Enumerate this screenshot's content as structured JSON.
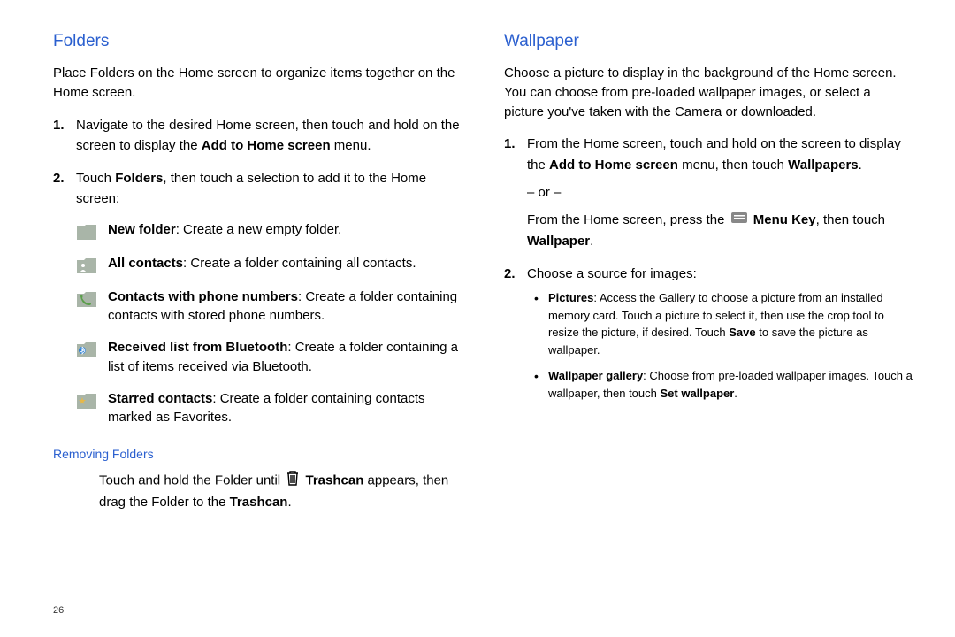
{
  "page_number": "26",
  "left": {
    "title": "Folders",
    "intro": "Place Folders on the Home screen to organize items together on the Home screen.",
    "step1_a": "Navigate to the desired Home screen, then touch and hold on the screen to display the ",
    "step1_bold": "Add to Home screen",
    "step1_b": " menu.",
    "step2_a": "Touch ",
    "step2_bold": "Folders",
    "step2_b": ", then touch a selection to add it to the Home screen:",
    "items": [
      {
        "bold": "New folder",
        "rest": ": Create a new empty folder."
      },
      {
        "bold": "All contacts",
        "rest": ": Create a folder containing all contacts."
      },
      {
        "bold": "Contacts with phone numbers",
        "rest": ": Create a folder containing contacts with stored phone numbers."
      },
      {
        "bold": "Received list from Bluetooth",
        "rest": ": Create a folder containing a list of items received via Bluetooth."
      },
      {
        "bold": "Starred contacts",
        "rest": ": Create a folder containing contacts marked as Favorites."
      }
    ],
    "removing_title": "Removing Folders",
    "removing_a": "Touch and hold the Folder until ",
    "removing_bold1": "Trashcan",
    "removing_b": " appears, then drag the Folder to the ",
    "removing_bold2": "Trashcan",
    "removing_c": "."
  },
  "right": {
    "title": "Wallpaper",
    "intro": "Choose a picture to display in the background of the Home screen. You can choose from pre-loaded wallpaper images, or select a picture you've taken with the Camera or downloaded.",
    "s1_a": "From the Home screen, touch and hold on the screen to display the ",
    "s1_b1": "Add to Home screen",
    "s1_b": " menu, then touch ",
    "s1_b2": "Wallpapers",
    "s1_c": ".",
    "or": "– or –",
    "s1_d": "From the Home screen, press the ",
    "s1_b3": "Menu Key",
    "s1_e": ", then touch ",
    "s1_b4": "Wallpaper",
    "s1_f": ".",
    "s2": "Choose a source for images:",
    "bul1_b": "Pictures",
    "bul1_a": ": Access the Gallery to choose a picture from an installed memory card. Touch a picture to select it, then use the crop tool to resize the picture, if desired. Touch ",
    "bul1_b2": "Save",
    "bul1_c": " to save the picture as wallpaper.",
    "bul2_b": "Wallpaper gallery",
    "bul2_a": ": Choose from pre-loaded wallpaper images. Touch a wallpaper, then touch ",
    "bul2_b2": "Set wallpaper",
    "bul2_c": "."
  }
}
